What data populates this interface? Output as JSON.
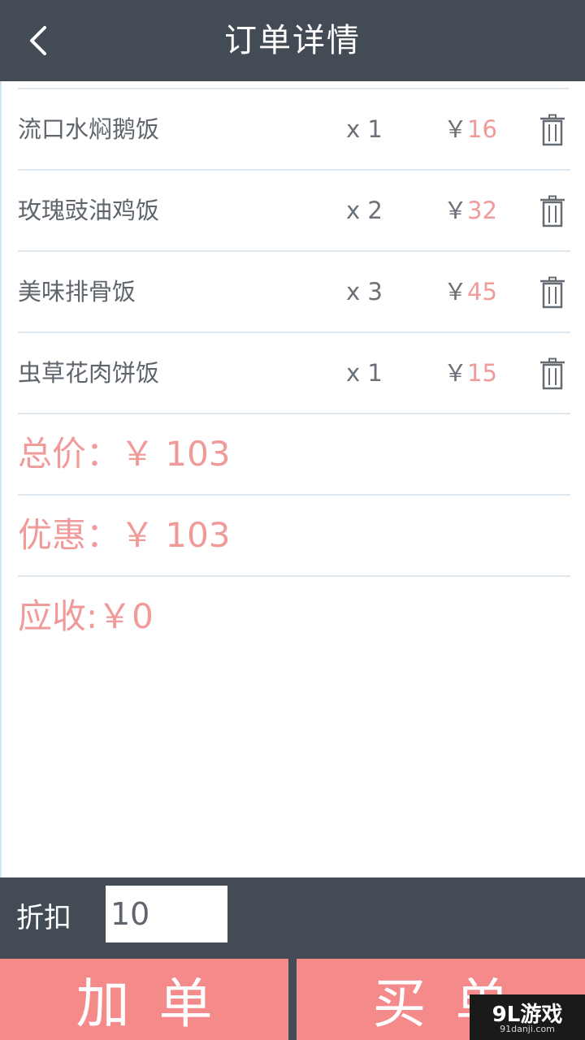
{
  "header": {
    "title": "订单详情"
  },
  "items": [
    {
      "name": "流口水焖鹅饭",
      "qty": "x 1",
      "yen": "￥",
      "price": "16"
    },
    {
      "name": "玫瑰豉油鸡饭",
      "qty": "x 2",
      "yen": "￥",
      "price": "32"
    },
    {
      "name": "美味排骨饭",
      "qty": "x 3",
      "yen": "￥",
      "price": "45"
    },
    {
      "name": "虫草花肉饼饭",
      "qty": "x 1",
      "yen": "￥",
      "price": "15"
    }
  ],
  "summary": {
    "total": "总价：￥ 103",
    "discount": "优惠：￥ 103",
    "receivable": "应收:￥0"
  },
  "footer": {
    "discount_label": "折扣",
    "discount_value": "10",
    "add_order": "加单",
    "pay": "买单"
  },
  "watermark": {
    "logo": "9L游戏",
    "site": "91danji.com"
  },
  "colors": {
    "header_bg": "#434b55",
    "accent_pink": "#f19a9a",
    "button_pink": "#f48a8a",
    "text_gray": "#5f656c"
  },
  "icons": {
    "back": "chevron-left-icon",
    "delete": "trash-icon"
  }
}
